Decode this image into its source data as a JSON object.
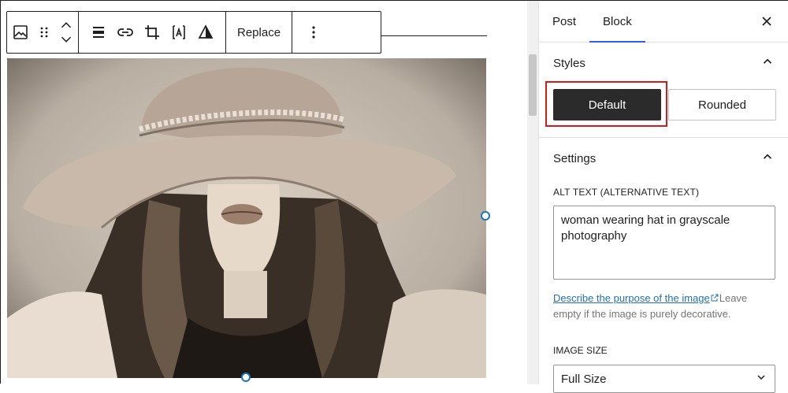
{
  "toolbar": {
    "replace_label": "Replace",
    "icons": [
      "image-icon",
      "drag-handle-icon",
      "move-up-icon",
      "move-down-icon",
      "align-icon",
      "link-icon",
      "crop-icon",
      "text-overlay-icon",
      "duotone-icon",
      "more-options-icon"
    ]
  },
  "image": {
    "description": "woman wearing hat in grayscale photography"
  },
  "sidebar": {
    "tabs": [
      {
        "label": "Post"
      },
      {
        "label": "Block"
      }
    ],
    "active_tab": "Block",
    "styles": {
      "title": "Styles",
      "default_label": "Default",
      "rounded_label": "Rounded",
      "selected": "Default"
    },
    "settings": {
      "title": "Settings",
      "alt_label": "ALT TEXT (ALTERNATIVE TEXT)",
      "alt_value": "woman wearing hat in grayscale photography",
      "help_link": "Describe the purpose of the image",
      "help_rest": "Leave empty if the image is purely decorative.",
      "image_size_label": "IMAGE SIZE",
      "image_size_value": "Full Size"
    }
  },
  "colors": {
    "accent": "#3858e9",
    "highlight": "#d61a1a",
    "dark_button": "#2b2b2b",
    "link": "#2271b1"
  }
}
